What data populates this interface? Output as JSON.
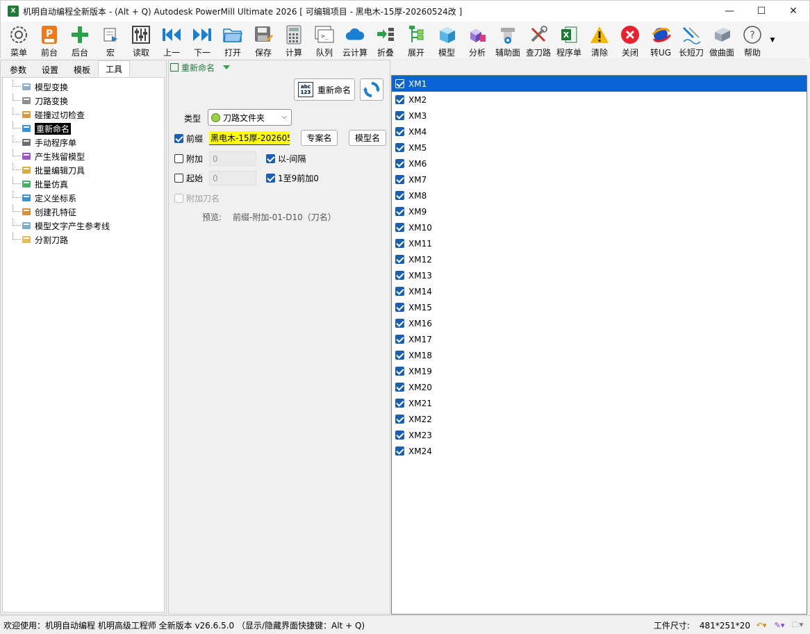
{
  "window": {
    "title": "机明自动编程全新版本 - (Alt + Q) Autodesk PowerMill Ultimate 2026    [ 可编辑项目 - 黑电木-15厚-20260524改 ]",
    "app_icon_text": "X",
    "minimize": "—",
    "maximize": "☐",
    "close": "✕"
  },
  "toolbar": [
    {
      "label": "菜单",
      "icon": "gear-icon"
    },
    {
      "label": "前台",
      "icon": "powermill-p-icon"
    },
    {
      "label": "后台",
      "icon": "plus-icon"
    },
    {
      "label": "宏",
      "icon": "macro-icon"
    },
    {
      "label": "读取",
      "icon": "sliders-icon"
    },
    {
      "label": "上一",
      "icon": "previous-icon"
    },
    {
      "label": "下一",
      "icon": "next-icon"
    },
    {
      "label": "打开",
      "icon": "folder-open-icon"
    },
    {
      "label": "保存",
      "icon": "save-icon"
    },
    {
      "label": "计算",
      "icon": "calculator-icon"
    },
    {
      "label": "队列",
      "icon": "queue-terminal-icon"
    },
    {
      "label": "云计算",
      "icon": "cloud-icon"
    },
    {
      "label": "折叠",
      "icon": "collapse-icon"
    },
    {
      "label": "展开",
      "icon": "expand-tree-icon"
    },
    {
      "label": "模型",
      "icon": "cube-icon"
    },
    {
      "label": "分析",
      "icon": "analysis-icon"
    },
    {
      "label": "辅助面",
      "icon": "aux-surface-icon"
    },
    {
      "label": "查刀路",
      "icon": "tools-icon"
    },
    {
      "label": "程序单",
      "icon": "excel-icon"
    },
    {
      "label": "清除",
      "icon": "warning-icon"
    },
    {
      "label": "关闭",
      "icon": "close-circle-icon"
    },
    {
      "label": "转UG",
      "icon": "ug-icon"
    },
    {
      "label": "长短刀",
      "icon": "tool-length-icon"
    },
    {
      "label": "做曲面",
      "icon": "surface-icon"
    },
    {
      "label": "帮助",
      "icon": "help-icon"
    }
  ],
  "left": {
    "tabs": [
      "参数",
      "设置",
      "模板",
      "工具"
    ],
    "active_tab": 3,
    "tree": [
      {
        "label": "模型变换",
        "icon": "model-transform-icon"
      },
      {
        "label": "刀路变换",
        "icon": "toolpath-transform-icon"
      },
      {
        "label": "碰撞过切检查",
        "icon": "collision-check-icon"
      },
      {
        "label": "重新命名",
        "icon": "rename-icon",
        "selected": true
      },
      {
        "label": "手动程序单",
        "icon": "manual-program-icon"
      },
      {
        "label": "产生残留模型",
        "icon": "stock-model-icon"
      },
      {
        "label": "批量编辑刀具",
        "icon": "batch-tool-icon"
      },
      {
        "label": "批量仿真",
        "icon": "batch-simulate-icon"
      },
      {
        "label": "定义坐标系",
        "icon": "workplane-icon"
      },
      {
        "label": "创建孔特征",
        "icon": "hole-feature-icon"
      },
      {
        "label": "模型文字产生参考线",
        "icon": "text-pattern-icon"
      },
      {
        "label": "分割刀路",
        "icon": "split-toolpath-icon"
      }
    ]
  },
  "mid": {
    "header": "重新命名",
    "rename_button": "重新命名",
    "rename_icon_text": "abc\n123",
    "type_label": "类型",
    "type_value": "刀路文件夹",
    "prefix_label": "前缀",
    "prefix_value": "黑电木-15厚-202605",
    "project_name_button": "专案名",
    "model_name_button": "模型名",
    "append_label": "附加",
    "append_value": "0",
    "dash_sep_label": "以-间隔",
    "start_label": "起始",
    "start_value": "0",
    "pad_zero_label": "1至9前加0",
    "append_tool_label": "附加刀名",
    "preview_label": "预览:",
    "preview_value": "前缀-附加-01-D10（刀名）"
  },
  "list": {
    "items": [
      "XM1",
      "XM2",
      "XM3",
      "XM4",
      "XM5",
      "XM6",
      "XM7",
      "XM8",
      "XM9",
      "XM10",
      "XM11",
      "XM12",
      "XM13",
      "XM14",
      "XM15",
      "XM16",
      "XM17",
      "XM18",
      "XM19",
      "XM20",
      "XM21",
      "XM22",
      "XM23",
      "XM24"
    ]
  },
  "status": {
    "welcome": "欢迎使用：机明自动编程 机明高级工程师 全新版本 v26.6.5.0  （显示/隐藏界面快捷键：Alt + Q)",
    "size_label": "工件尺寸:",
    "size_value": "481*251*20"
  },
  "colors": {
    "accent": "#0a64d6",
    "highlight": "#ffff00",
    "green": "#1f7a3a"
  }
}
